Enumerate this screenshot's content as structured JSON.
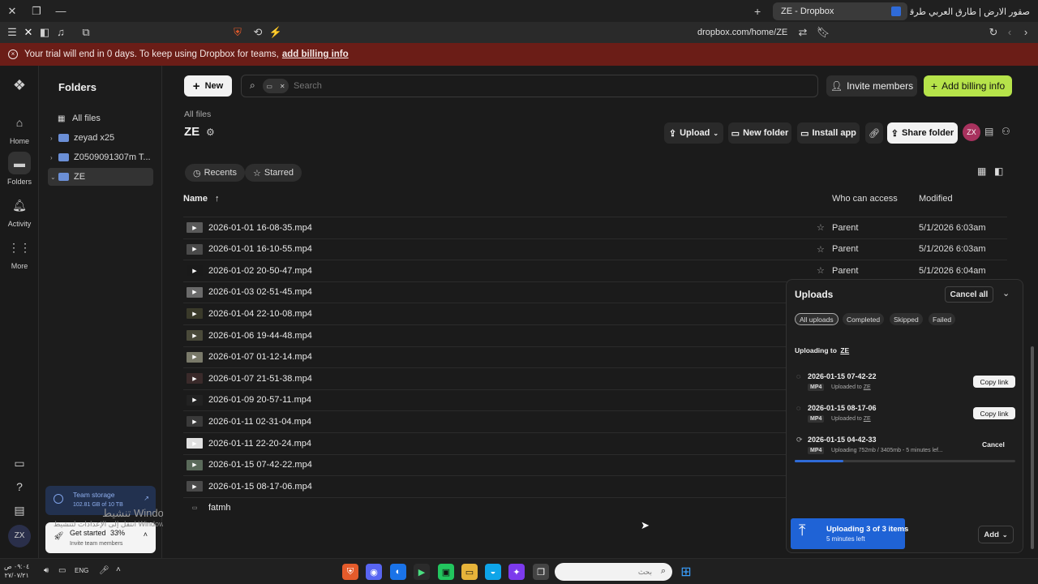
{
  "browser": {
    "tabs": [
      {
        "label": "ZE - Dropbox"
      },
      {
        "label": "صقور الارض | طارق العربي طرقان - ..."
      }
    ],
    "url": "dropbox.com/home/ZE"
  },
  "banner": {
    "text": "Your trial will end in 0 days. To keep using Dropbox for teams,",
    "link": "add billing info"
  },
  "rail": {
    "items": [
      {
        "label": "Home",
        "icon": "home-icon"
      },
      {
        "label": "Folders",
        "icon": "folder-icon"
      },
      {
        "label": "Activity",
        "icon": "bell-icon"
      },
      {
        "label": "More",
        "icon": "grid-icon"
      }
    ],
    "avatar": "ZX"
  },
  "folders": {
    "title": "Folders",
    "items": [
      {
        "label": "All files"
      },
      {
        "label": "zeyad x25"
      },
      {
        "label": "Z0509091307m T..."
      },
      {
        "label": "ZE"
      }
    ],
    "storage": {
      "title": "Team storage",
      "detail": "102.81 GB of 10 TB"
    },
    "get_started": {
      "title": "Get started",
      "percent": "33%",
      "sub": "Invite team members"
    },
    "activate_windows": {
      "line1": "تنشيط Windows",
      "line2": "انتقل إلى الإعدادات لتنشيط Windows."
    }
  },
  "main": {
    "new_label": "New",
    "search_placeholder": "Search",
    "invite_label": "Invite members",
    "billing_label": "Add billing info",
    "breadcrumb": "All files",
    "folder_title": "ZE",
    "actions": {
      "upload": "Upload",
      "new_folder": "New folder",
      "install_app": "Install app",
      "share_folder": "Share folder",
      "avatar": "ZX"
    },
    "filters": {
      "recents": "Recents",
      "starred": "Starred"
    },
    "columns": {
      "name": "Name",
      "access": "Who can access",
      "modified": "Modified"
    },
    "files": [
      {
        "name": "2026-01-01 16-08-35.mp4",
        "access": "Parent",
        "modified": "5/1/2026 6:03am"
      },
      {
        "name": "2026-01-01 16-10-55.mp4",
        "access": "Parent",
        "modified": "5/1/2026 6:03am"
      },
      {
        "name": "2026-01-02 20-50-47.mp4",
        "access": "Parent",
        "modified": "5/1/2026 6:04am"
      },
      {
        "name": "2026-01-03 02-51-45.mp4",
        "access": "",
        "modified": ""
      },
      {
        "name": "2026-01-04 22-10-08.mp4",
        "access": "",
        "modified": ""
      },
      {
        "name": "2026-01-06 19-44-48.mp4",
        "access": "",
        "modified": ""
      },
      {
        "name": "2026-01-07 01-12-14.mp4",
        "access": "",
        "modified": ""
      },
      {
        "name": "2026-01-07 21-51-38.mp4",
        "access": "",
        "modified": ""
      },
      {
        "name": "2026-01-09 20-57-11.mp4",
        "access": "",
        "modified": ""
      },
      {
        "name": "2026-01-11 02-31-04.mp4",
        "access": "",
        "modified": ""
      },
      {
        "name": "2026-01-11 22-20-24.mp4",
        "access": "",
        "modified": ""
      },
      {
        "name": "2026-01-15 07-42-22.mp4",
        "access": "",
        "modified": ""
      },
      {
        "name": "2026-01-15 08-17-06.mp4",
        "access": "",
        "modified": ""
      },
      {
        "name": "fatmh",
        "access": "",
        "modified": ""
      }
    ]
  },
  "uploads": {
    "title": "Uploads",
    "cancel_all": "Cancel all",
    "tabs": [
      "All uploads",
      "Completed",
      "Skipped",
      "Failed"
    ],
    "uploading_to": "Uploading to",
    "target": "ZE",
    "items": [
      {
        "name": "2026-01-15 07-42-22",
        "type": "MP4",
        "sub": "Uploaded to",
        "target": "ZE",
        "action": "Copy link"
      },
      {
        "name": "2026-01-15 08-17-06",
        "type": "MP4",
        "sub": "Uploaded to",
        "target": "ZE",
        "action": "Copy link"
      },
      {
        "name": "2026-01-15 04-42-33",
        "type": "MP4",
        "sub": "Uploading 752mb / 3405mb - 5 minutes lef...",
        "target": "",
        "action": "Cancel",
        "progress": 0.22
      }
    ],
    "footer": {
      "title": "Uploading 3 of 3 items",
      "sub": "5 minutes left",
      "add": "Add"
    }
  },
  "taskbar": {
    "time": "٠٩:٠٤ ص",
    "date": "٢٧/٠٧/٢١",
    "lang": "ENG",
    "search_placeholder": "بحث"
  }
}
